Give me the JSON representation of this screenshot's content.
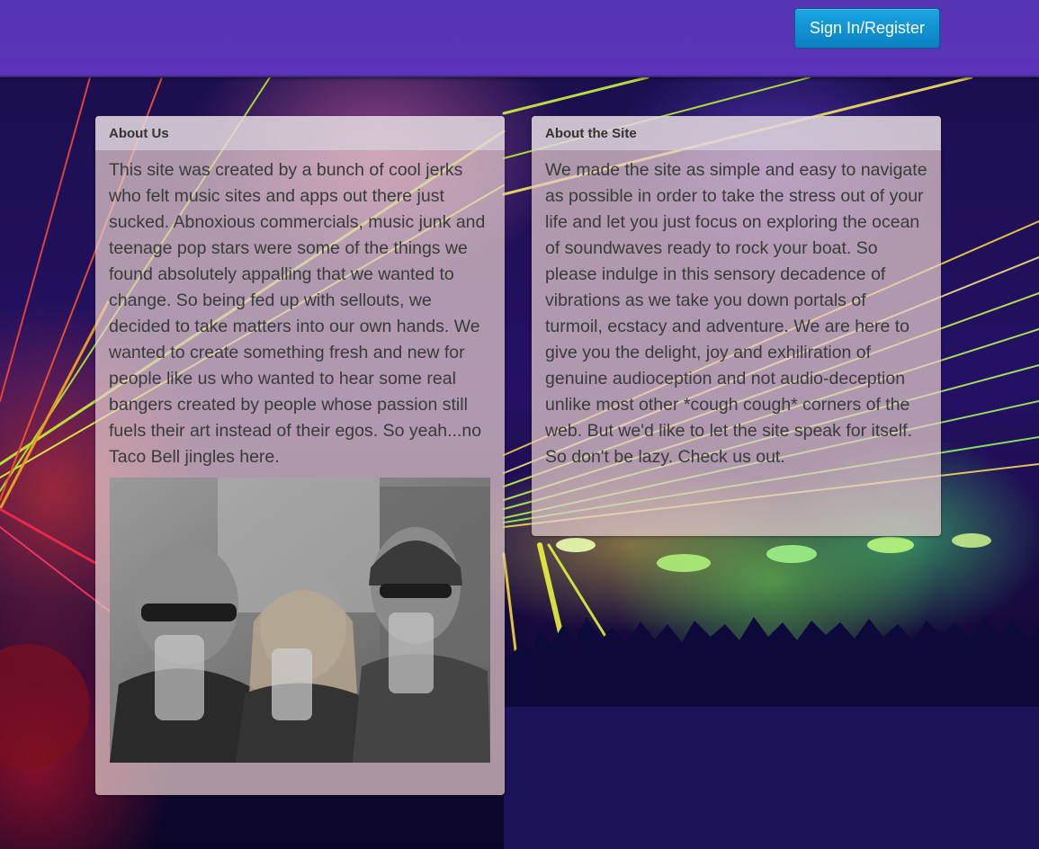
{
  "navbar": {
    "signin_label": "Sign In/Register",
    "background_color": "#5635b3",
    "button_color": "#0a7fc0"
  },
  "about_us": {
    "heading": "About Us",
    "body": "This site was created by a bunch of cool jerks who felt music sites and apps out there just sucked. Abnoxious commercials, music junk and teenage pop stars were some of the things we found absolutely appalling that we wanted to change. So being fed up with sellouts, we decided to take matters into our own hands. We wanted to create something fresh and new for people like us who wanted to hear some real bangers created by people whose passion still fuels their art instead of their egos. So yeah...no Taco Bell jingles here.",
    "photo_icon": "group-photo"
  },
  "about_site": {
    "heading": "About the Site",
    "body": "We made the site as simple and easy to navigate as possible in order to take the stress out of your life and let you just focus on exploring the ocean of soundwaves ready to rock your boat. So please indulge in this sensory decadence of vibrations as we take you down portals of turmoil, ecstacy and adventure. We are here to give you the delight, joy and exhiliration of genuine audioception and not audio-deception unlike most other *cough cough* corners of the web. But we'd like to let the site speak for itself. So don't be lazy. Check us out."
  },
  "background": {
    "icon": "concert-laser-background"
  }
}
